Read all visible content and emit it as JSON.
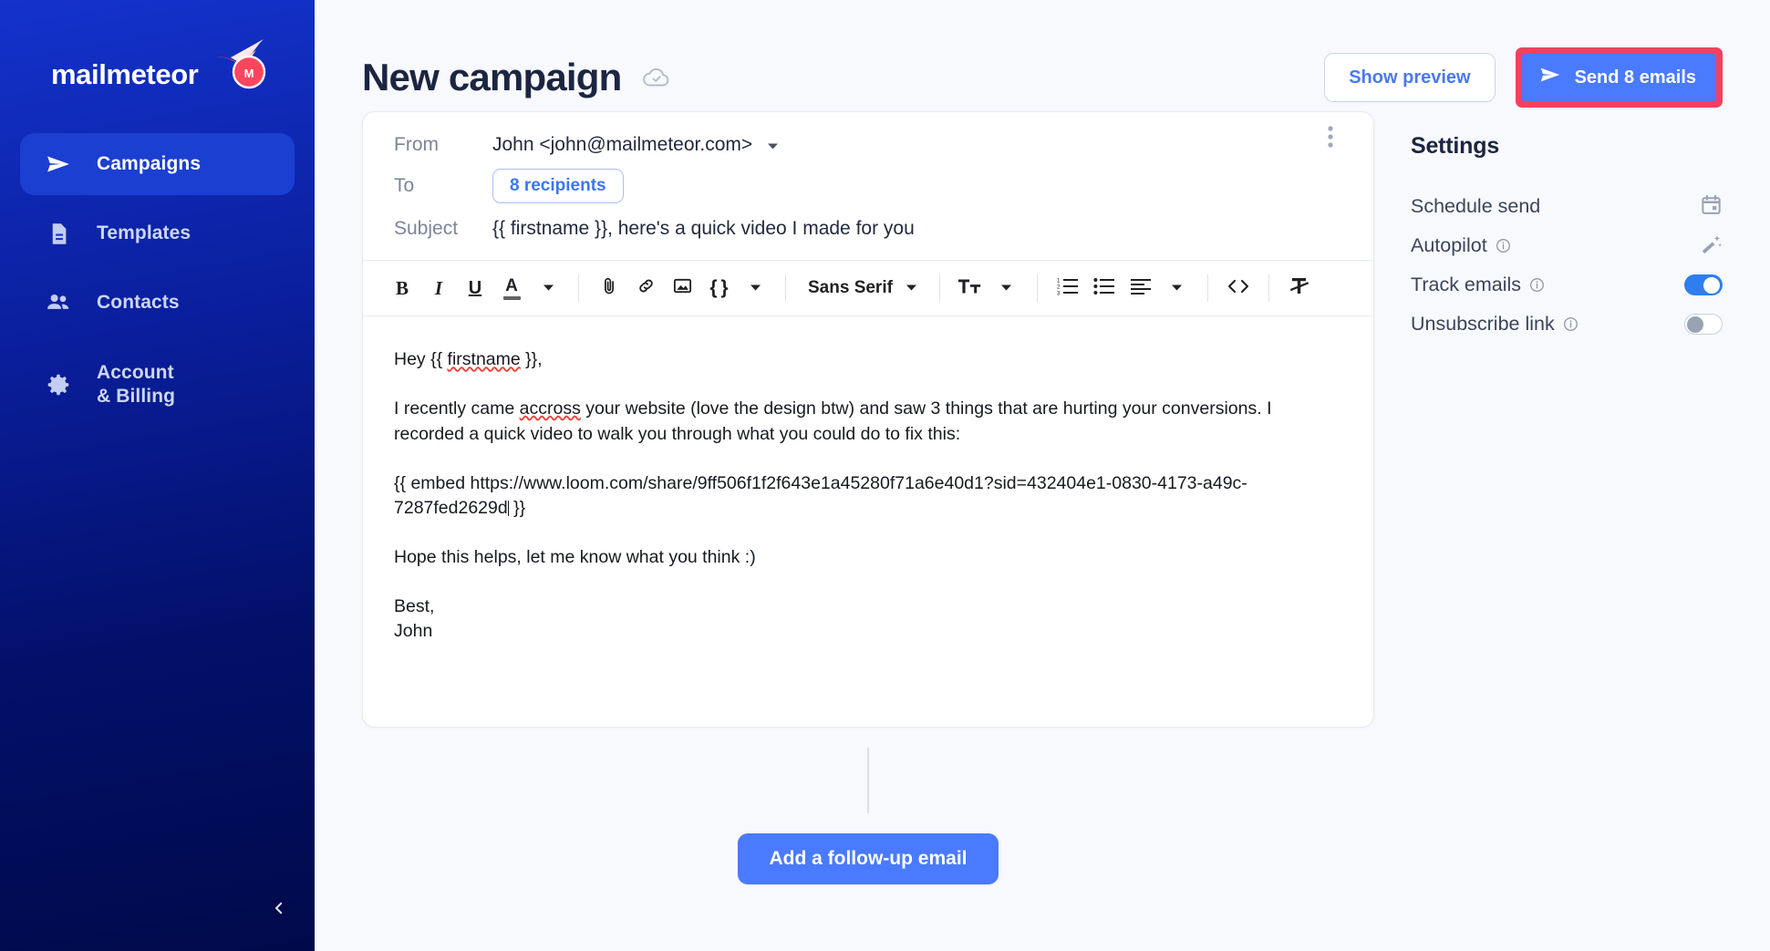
{
  "brand": {
    "name": "mailmeteor",
    "logo_icon": "meteor-logo-icon"
  },
  "sidebar": {
    "items": [
      {
        "label": "Campaigns",
        "icon": "send-icon",
        "active": true
      },
      {
        "label": "Templates",
        "icon": "document-icon",
        "active": false
      },
      {
        "label": "Contacts",
        "icon": "people-icon",
        "active": false
      },
      {
        "label": "Account\n& Billing",
        "icon": "gear-icon",
        "active": false
      }
    ],
    "collapse_icon": "chevron-left-icon"
  },
  "header": {
    "title": "New campaign",
    "saved_icon": "cloud-check-icon",
    "show_preview_label": "Show preview",
    "send_label": "Send 8 emails",
    "send_icon": "send-icon",
    "send_highlight_color": "#f2415f",
    "send_button_color": "#4a7afd"
  },
  "compose": {
    "from_label": "From",
    "from_value": "John <john@mailmeteor.com>",
    "to_label": "To",
    "recipients_chip": "8 recipients",
    "subject_label": "Subject",
    "subject_value": "{{ firstname }}, here's a quick video I made for you",
    "menu_icon": "kebab-menu-icon",
    "toolbar": {
      "bold": "B",
      "italic": "I",
      "underline": "U",
      "text_color": "A",
      "attach_icon": "paperclip-icon",
      "link_icon": "link-icon",
      "image_icon": "image-icon",
      "merge_tag": "{ }",
      "font_family": "Sans Serif",
      "font_size_icon": "font-size-icon",
      "numbered_list_icon": "numbered-list-icon",
      "bullet_list_icon": "bullet-list-icon",
      "align_icon": "align-left-icon",
      "code_icon": "code-icon",
      "clear_format_icon": "clear-formatting-icon"
    },
    "body": {
      "greeting": "Hey {{ firstname }},",
      "paragraph": "I recently came accross your website (love the design btw) and saw 3 things that are hurting your conversions. I recorded a quick video to walk you through what you could do to fix this:",
      "embed": "{{ embed https://www.loom.com/share/9ff506f1f2f643e1a45280f71a6e40d1?sid=432404e1-0830-4173-a49c-7287fed2629d }}",
      "closing": "Hope this helps, let me know what you think :)",
      "signoff": "Best,",
      "signature": "John",
      "misspelled": [
        "firstname",
        "accross"
      ]
    }
  },
  "followup": {
    "label": "Add a follow-up email"
  },
  "settings": {
    "title": "Settings",
    "rows": [
      {
        "label": "Schedule send",
        "control": "icon",
        "icon": "calendar-icon",
        "has_info": false
      },
      {
        "label": "Autopilot",
        "control": "icon",
        "icon": "magic-wand-icon",
        "has_info": true
      },
      {
        "label": "Track emails",
        "control": "toggle",
        "value": "on",
        "has_info": true
      },
      {
        "label": "Unsubscribe link",
        "control": "toggle",
        "value": "off",
        "has_info": true
      }
    ]
  }
}
